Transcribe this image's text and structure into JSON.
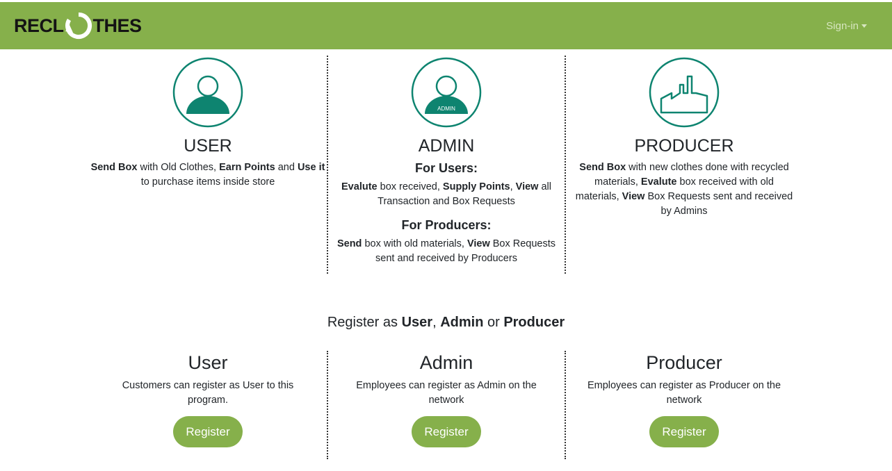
{
  "brand": {
    "left": "RECL",
    "right": "THES"
  },
  "nav": {
    "signin_label": "Sign-in"
  },
  "roles": {
    "user": {
      "title": "USER",
      "desc": [
        {
          "b": "Send Box"
        },
        {
          "t": " with Old Clothes, "
        },
        {
          "b": "Earn Points"
        },
        {
          "t": " and "
        },
        {
          "b": "Use it"
        },
        {
          "t": " to purchase items inside store"
        }
      ]
    },
    "admin": {
      "title": "ADMIN",
      "badge": "ADMIN",
      "for_users_heading": "For Users:",
      "for_users_desc": [
        {
          "b": "Evalute"
        },
        {
          "t": " box received, "
        },
        {
          "b": "Supply Points"
        },
        {
          "t": ", "
        },
        {
          "b": "View"
        },
        {
          "t": " all Transaction and Box Requests"
        }
      ],
      "for_producers_heading": "For Producers:",
      "for_producers_desc": [
        {
          "b": "Send"
        },
        {
          "t": " box with old materials, "
        },
        {
          "b": "View"
        },
        {
          "t": " Box Requests sent and received by Producers"
        }
      ]
    },
    "producer": {
      "title": "PRODUCER",
      "desc": [
        {
          "b": "Send Box"
        },
        {
          "t": " with new clothes done with recycled materials, "
        },
        {
          "b": "Evalute"
        },
        {
          "t": " box received with old materials, "
        },
        {
          "b": "View"
        },
        {
          "t": " Box Requests sent and received by Admins"
        }
      ]
    }
  },
  "register": {
    "heading": [
      {
        "t": "Register as "
      },
      {
        "b": "User"
      },
      {
        "t": ", "
      },
      {
        "b": "Admin"
      },
      {
        "t": " or "
      },
      {
        "b": "Producer"
      }
    ],
    "cards": [
      {
        "title": "User",
        "desc": "Customers can register as User to this program.",
        "button": "Register"
      },
      {
        "title": "Admin",
        "desc": "Employees can register as Admin on the network",
        "button": "Register"
      },
      {
        "title": "Producer",
        "desc": "Employees can register as Producer on the network",
        "button": "Register"
      }
    ]
  },
  "colors": {
    "brand_green": "#86b04b",
    "icon_teal": "#0e8470"
  },
  "icons": {
    "user": "person-icon",
    "admin": "admin-person-icon",
    "producer": "factory-icon",
    "logo": "recycle-arrow-icon"
  }
}
